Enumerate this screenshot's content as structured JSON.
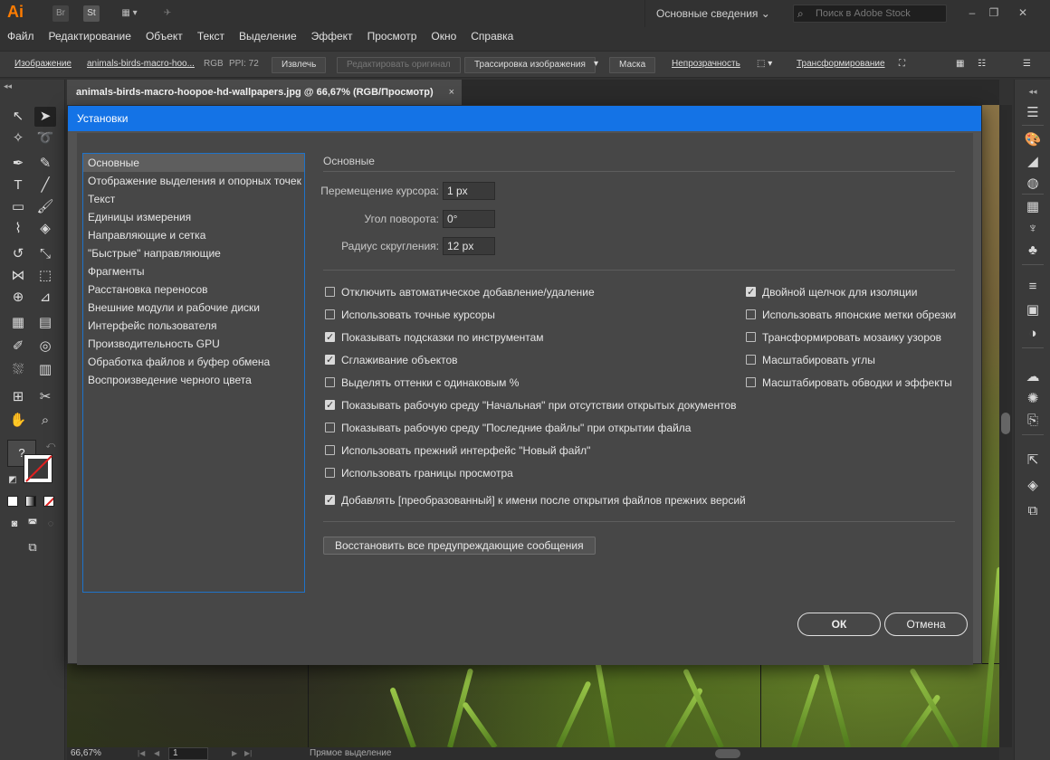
{
  "app": {
    "logo": "Ai",
    "bridge": "Br",
    "stock": "St",
    "workspace": "Основные сведения",
    "stock_search_placeholder": "Поиск в Adobe Stock"
  },
  "menu": [
    "Файл",
    "Редактирование",
    "Объект",
    "Текст",
    "Выделение",
    "Эффект",
    "Просмотр",
    "Окно",
    "Справка"
  ],
  "control_bar": {
    "type_label": "Изображение",
    "file_name": "animals-birds-macro-hoo...",
    "color_mode": "RGB",
    "ppi": "PPI: 72",
    "extract": "Извлечь",
    "edit_original": "Редактировать оригинал",
    "image_trace": "Трассировка изображения",
    "mask": "Маска",
    "opacity": "Непрозрачность",
    "transform": "Трансформирование"
  },
  "document_tab": {
    "title": "animals-birds-macro-hoopoe-hd-wallpapers.jpg @ 66,67% (RGB/Просмотр)",
    "close": "×"
  },
  "dialog": {
    "title": "Установки",
    "nav": [
      "Основные",
      "Отображение выделения и опорных точек",
      "Текст",
      "Единицы измерения",
      "Направляющие и сетка",
      "\"Быстрые\" направляющие",
      "Фрагменты",
      "Расстановка переносов",
      "Внешние модули и рабочие диски",
      "Интерфейс пользователя",
      "Производительность GPU",
      "Обработка файлов и буфер обмена",
      "Воспроизведение черного цвета"
    ],
    "active_nav": "Основные",
    "section_title": "Основные",
    "fields": [
      {
        "label": "Перемещение курсора:",
        "value": "1 px"
      },
      {
        "label": "Угол поворота:",
        "value": "0°"
      },
      {
        "label": "Радиус скругления:",
        "value": "12 px"
      }
    ],
    "checkboxes_left": [
      {
        "label": "Отключить автоматическое добавление/удаление",
        "checked": false
      },
      {
        "label": "Использовать точные курсоры",
        "checked": false
      },
      {
        "label": "Показывать подсказки по инструментам",
        "checked": true
      },
      {
        "label": "Сглаживание объектов",
        "checked": true
      },
      {
        "label": "Выделять оттенки с одинаковым %",
        "checked": false
      },
      {
        "label": "Показывать рабочую среду \"Начальная\" при отсутствии открытых документов",
        "checked": true
      },
      {
        "label": "Показывать рабочую среду \"Последние файлы\" при открытии файла",
        "checked": false
      },
      {
        "label": "Использовать прежний интерфейс \"Новый файл\"",
        "checked": false
      },
      {
        "label": "Использовать границы просмотра",
        "checked": false
      },
      {
        "label": "Добавлять [преобразованный] к имени после открытия файлов прежних версий",
        "checked": true
      }
    ],
    "checkboxes_right": [
      {
        "label": "Двойной щелчок для изоляции",
        "checked": true
      },
      {
        "label": "Использовать японские метки обрезки",
        "checked": false
      },
      {
        "label": "Трансформировать мозаику узоров",
        "checked": false
      },
      {
        "label": "Масштабировать углы",
        "checked": false
      },
      {
        "label": "Масштабировать обводки и эффекты",
        "checked": false
      }
    ],
    "restore_button": "Восстановить все предупреждающие сообщения",
    "ok": "ОК",
    "cancel": "Отмена"
  },
  "status": {
    "zoom": "66,67%",
    "page": "1",
    "tool_mode": "Прямое выделение"
  },
  "colors": {
    "accent": "#1473e6",
    "panel_bg": "#535353",
    "logo": "#ff7c00"
  }
}
